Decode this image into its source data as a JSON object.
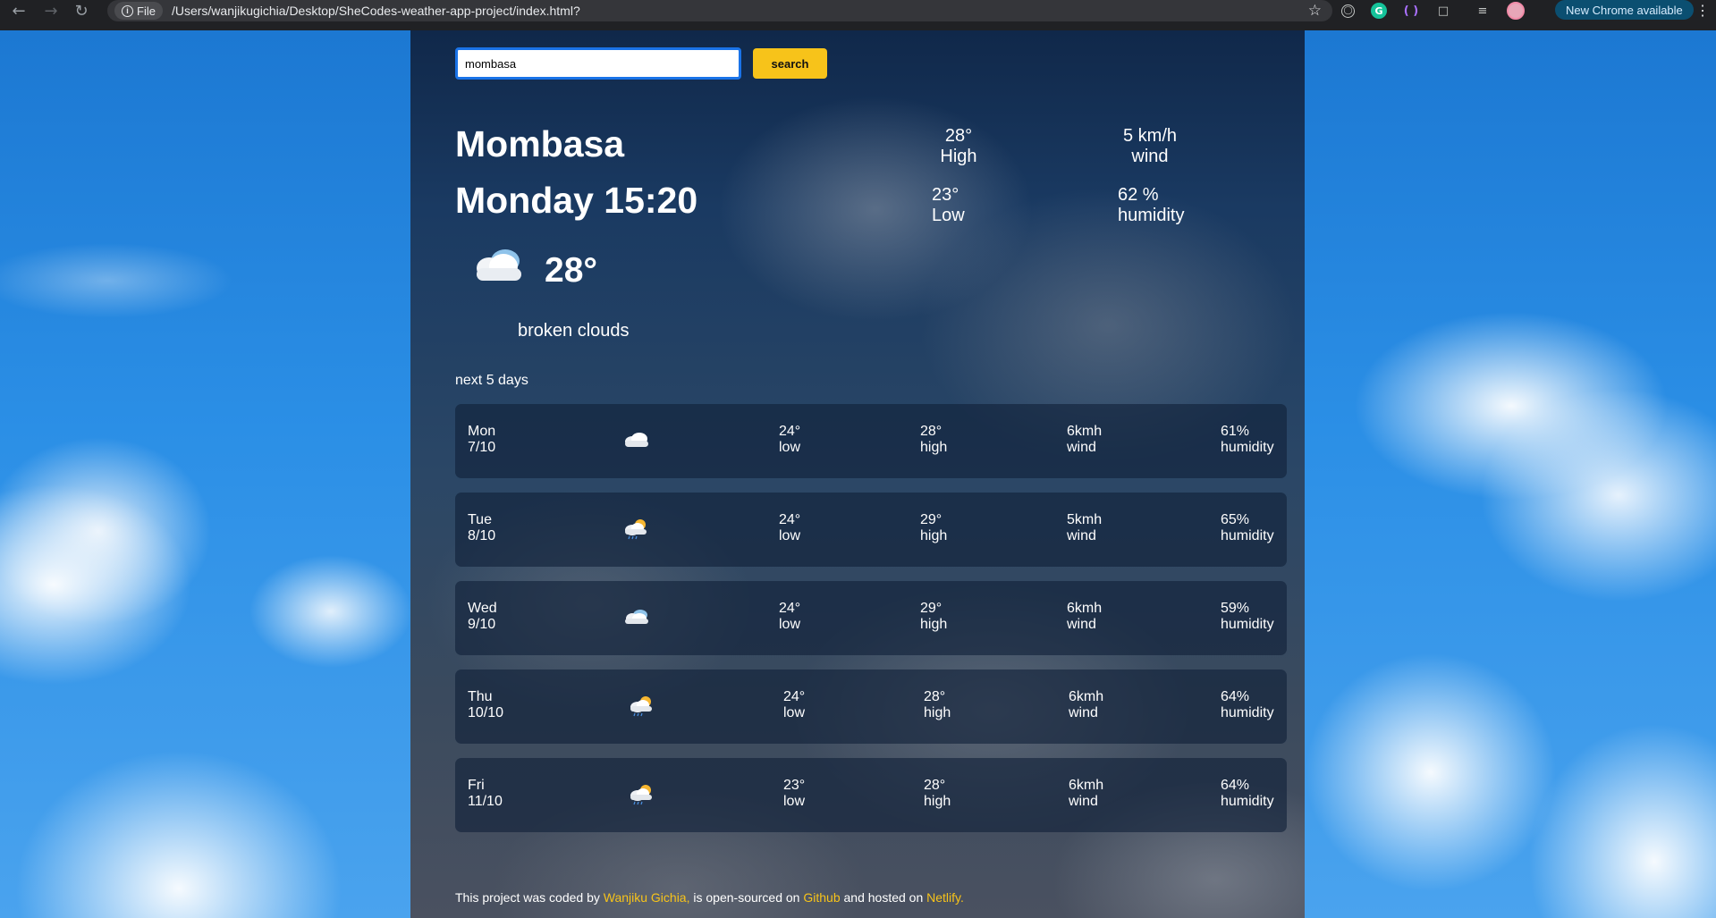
{
  "browser": {
    "file_label": "File",
    "url": "/Users/wanjikugichia/Desktop/SheCodes-weather-app-project/index.html?",
    "update_label": "New Chrome available"
  },
  "search": {
    "value": "mombasa",
    "button_label": "search"
  },
  "current": {
    "city": "Mombasa",
    "datetime": "Monday 15:20",
    "temperature": "28°",
    "description": "broken clouds",
    "high_value": "28°",
    "high_label": "High",
    "low_value": "23°",
    "low_label": "Low",
    "wind_value": "5 km/h",
    "wind_label": "wind",
    "humidity_value": "62 %",
    "humidity_label": "humidity",
    "icon": "broken-clouds-icon"
  },
  "forecast": {
    "title": "next 5 days",
    "days": [
      {
        "day": "Mon",
        "date": "7/10",
        "icon": "cloud-icon",
        "low": "24°",
        "low_label": "low",
        "high": "28°",
        "high_label": "high",
        "wind": "6kmh",
        "wind_label": "wind",
        "humidity": "61%",
        "humidity_label": "humidity"
      },
      {
        "day": "Tue",
        "date": "8/10",
        "icon": "sun-rain-icon",
        "low": "24°",
        "low_label": "low",
        "high": "29°",
        "high_label": "high",
        "wind": "5kmh",
        "wind_label": "wind",
        "humidity": "65%",
        "humidity_label": "humidity"
      },
      {
        "day": "Wed",
        "date": "9/10",
        "icon": "broken-clouds-icon",
        "low": "24°",
        "low_label": "low",
        "high": "29°",
        "high_label": "high",
        "wind": "6kmh",
        "wind_label": "wind",
        "humidity": "59%",
        "humidity_label": "humidity"
      },
      {
        "day": "Thu",
        "date": "10/10",
        "icon": "sun-rain-icon",
        "low": "24°",
        "low_label": "low",
        "high": "28°",
        "high_label": "high",
        "wind": "6kmh",
        "wind_label": "wind",
        "humidity": "64%",
        "humidity_label": "humidity"
      },
      {
        "day": "Fri",
        "date": "11/10",
        "icon": "sun-rain-icon",
        "low": "23°",
        "low_label": "low",
        "high": "28°",
        "high_label": "high",
        "wind": "6kmh",
        "wind_label": "wind",
        "humidity": "64%",
        "humidity_label": "humidity"
      }
    ]
  },
  "footer": {
    "part1": "This project was coded by ",
    "author": "Wanjiku Gichia,",
    "part2": " is open-sourced on ",
    "github": "Github",
    "part3": " and hosted on ",
    "netlify": "Netlify."
  },
  "colors": {
    "accent": "#f7c31a",
    "focus_ring": "#1a73e8",
    "update_chip": "#0b4f71"
  }
}
